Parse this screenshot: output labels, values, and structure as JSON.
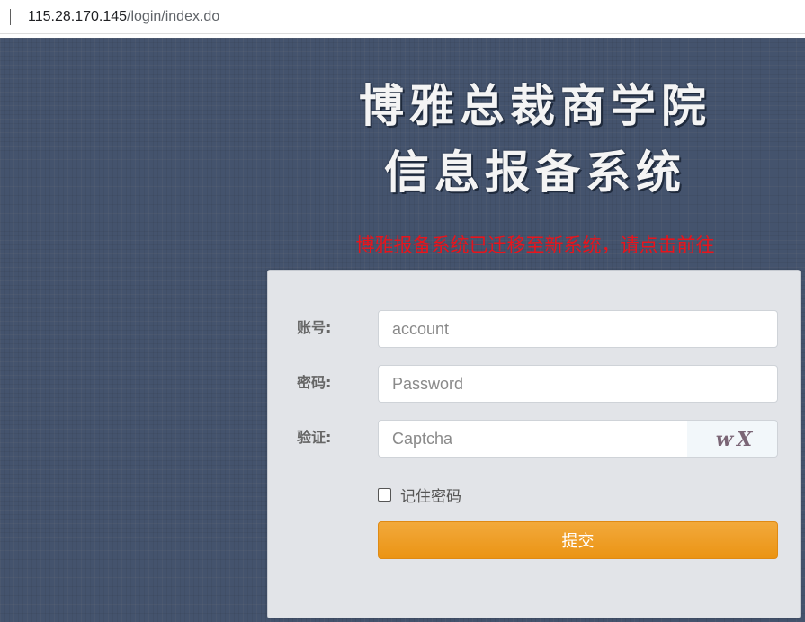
{
  "browser": {
    "url_host": "115.28.170.145",
    "url_path": "/login/index.do"
  },
  "header": {
    "title_line1": "博雅总裁商学院",
    "title_line2": "信息报备系统",
    "notice": "博雅报备系统已迁移至新系统，请点击前往",
    "notice_color": "#e8141c"
  },
  "form": {
    "account": {
      "label": "账号:",
      "placeholder": "account",
      "value": ""
    },
    "password": {
      "label": "密码:",
      "placeholder": "Password",
      "value": ""
    },
    "captcha": {
      "label": "验证:",
      "placeholder": "Captcha",
      "value": "",
      "image_text": "wX"
    },
    "remember_label": "记住密码",
    "remember_checked": false,
    "submit_label": "提交",
    "submit_color": "#eb9414"
  },
  "icons": {
    "checkbox": "checkbox-unchecked-icon"
  }
}
